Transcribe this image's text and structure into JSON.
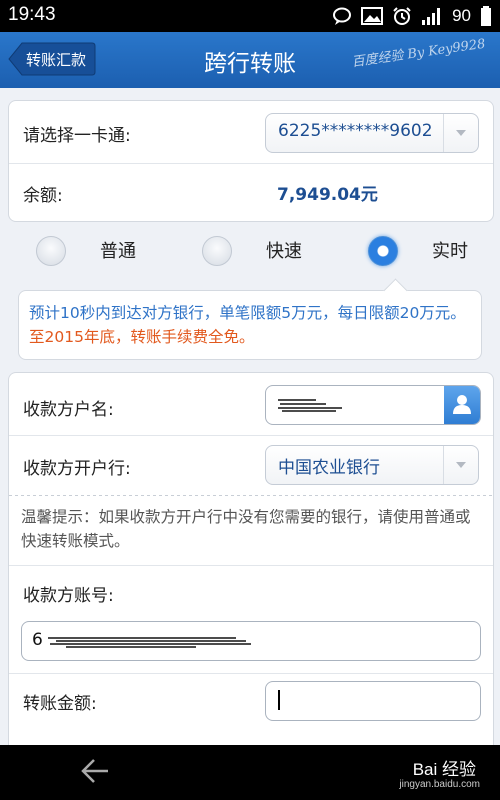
{
  "status_bar": {
    "time": "19:43",
    "battery": "90"
  },
  "header": {
    "back_label": "转账汇款",
    "title": "跨行转账",
    "watermark": "百度经验 By Key9928"
  },
  "account": {
    "select_label": "请选择一卡通:",
    "card_number": "6225********9602",
    "balance_label": "余额:",
    "balance_value": "7,949.04元"
  },
  "speed_options": [
    {
      "label": "普通",
      "selected": false
    },
    {
      "label": "快速",
      "selected": false
    },
    {
      "label": "实时",
      "selected": true
    }
  ],
  "info": {
    "text_blue": "预计10秒内到达对方银行，单笔限额5万元，每日限额20万元。",
    "text_red": "至2015年底，转账手续费全免。"
  },
  "payee": {
    "name_label": "收款方户名:",
    "bank_label": "收款方开户行:",
    "bank_value": "中国农业银行",
    "tip": "温馨提示：如果收款方开户行中没有您需要的银行，请使用普通或快速转账模式。",
    "account_label": "收款方账号:",
    "account_prefix": "6",
    "amount_label": "转账金额:"
  },
  "footer": {
    "baidu_logo": "Bai 经验",
    "baidu_url": "jingyan.baidu.com"
  },
  "colors": {
    "title_bar": "#1f64b4",
    "value_blue": "#1d4e92",
    "info_blue": "#2f73c7",
    "info_red": "#e2591e"
  }
}
